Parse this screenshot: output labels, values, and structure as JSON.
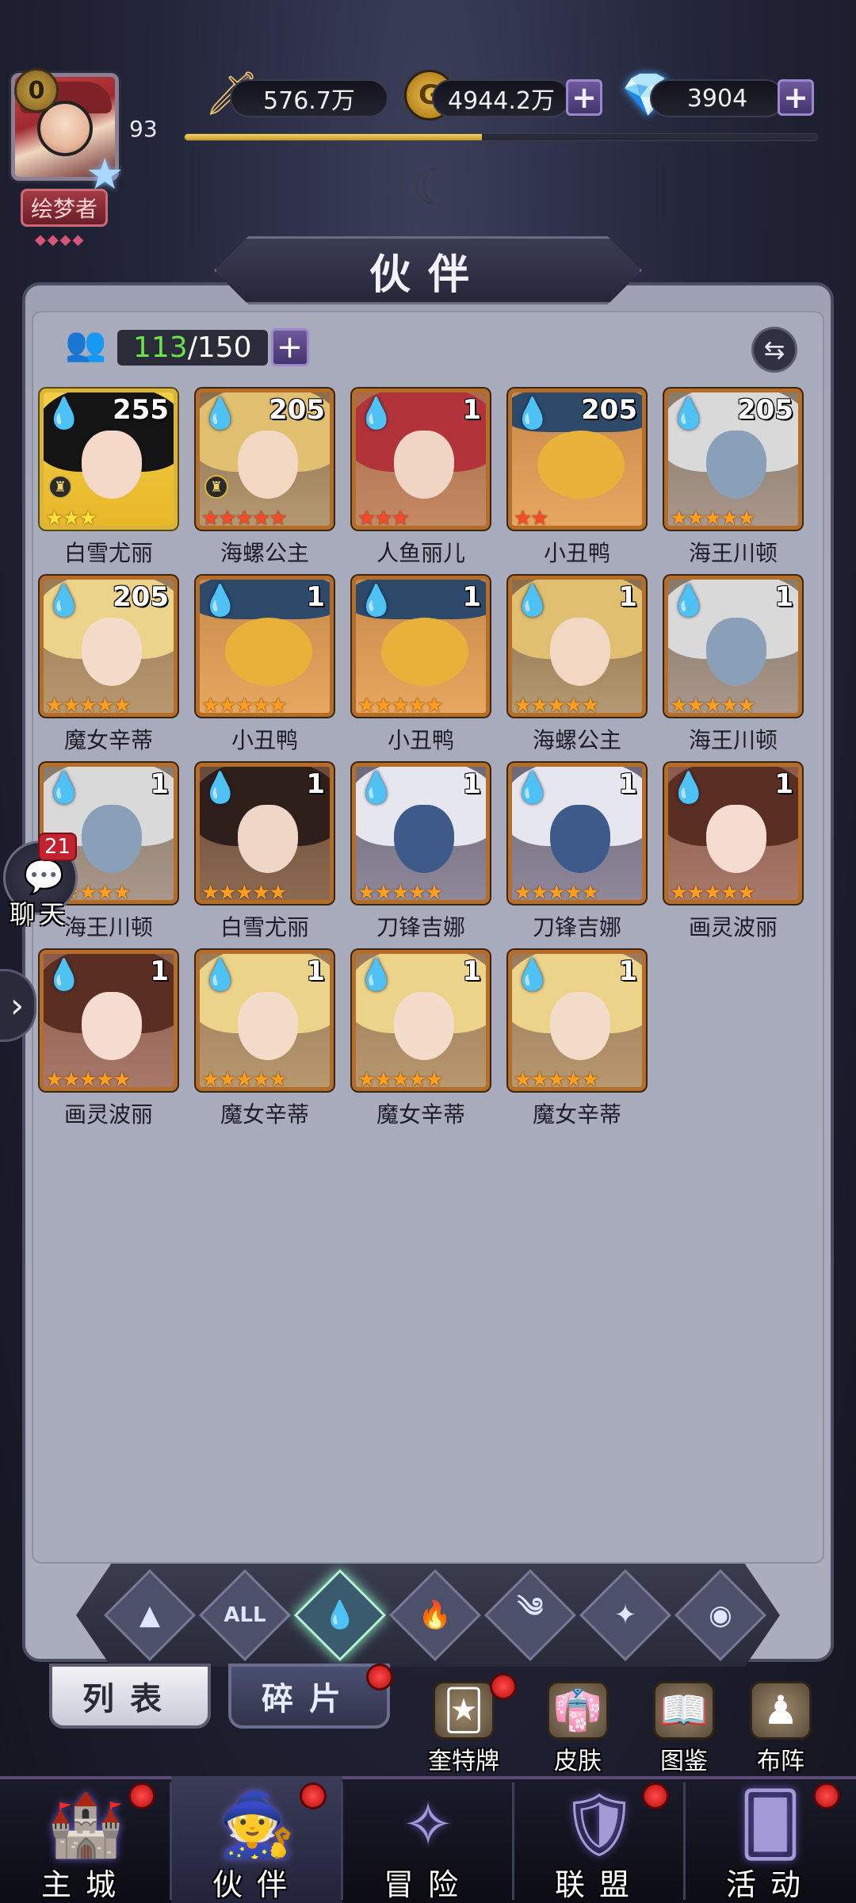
{
  "colors": {
    "accent_purple": "#6d5a9b",
    "panel_bg": "#a7abbb",
    "count_current": "#6ee24a",
    "red_dot": "#c32230",
    "frame_orange": "#b56d2a",
    "frame_gold": "#d9b53a"
  },
  "header": {
    "player_level_badge": "0",
    "player_level": "93",
    "player_title": "绘梦者",
    "power": "576.7万",
    "gold": "4944.2万",
    "gems": "3904",
    "exp_progress": 0.47,
    "panel_title": "伙伴"
  },
  "roster": {
    "count_current": "113",
    "count_max": "/150"
  },
  "heroes": [
    {
      "name": "白雪尤丽",
      "level": "255",
      "stars": 3,
      "star_color": "yellow",
      "frame": "gold",
      "palette": "snow",
      "crown": true
    },
    {
      "name": "海螺公主",
      "level": "205",
      "stars": 5,
      "star_color": "red",
      "frame": "orange",
      "palette": "sea",
      "crown": true
    },
    {
      "name": "人鱼丽儿",
      "level": "1",
      "stars": 3,
      "star_color": "red",
      "frame": "orange",
      "palette": "mer",
      "crown": false
    },
    {
      "name": "小丑鸭",
      "level": "205",
      "stars": 2,
      "star_color": "red",
      "frame": "orange",
      "palette": "duck",
      "crown": false
    },
    {
      "name": "海王川顿",
      "level": "205",
      "stars": 5,
      "star_color": "orange",
      "frame": "orange",
      "palette": "posei",
      "crown": false
    },
    {
      "name": "魔女辛蒂",
      "level": "205",
      "stars": 5,
      "star_color": "orange",
      "frame": "orange",
      "palette": "witch",
      "crown": false
    },
    {
      "name": "小丑鸭",
      "level": "1",
      "stars": 5,
      "star_color": "orange",
      "frame": "orange",
      "palette": "duck",
      "crown": false
    },
    {
      "name": "小丑鸭",
      "level": "1",
      "stars": 5,
      "star_color": "orange",
      "frame": "orange",
      "palette": "duck",
      "crown": false
    },
    {
      "name": "海螺公主",
      "level": "1",
      "stars": 5,
      "star_color": "orange",
      "frame": "orange",
      "palette": "sea",
      "crown": false
    },
    {
      "name": "海王川顿",
      "level": "1",
      "stars": 5,
      "star_color": "orange",
      "frame": "orange",
      "palette": "posei",
      "crown": false
    },
    {
      "name": "海王川顿",
      "level": "1",
      "stars": 5,
      "star_color": "orange",
      "frame": "orange",
      "palette": "posei",
      "crown": false
    },
    {
      "name": "白雪尤丽",
      "level": "1",
      "stars": 5,
      "star_color": "orange",
      "frame": "orange",
      "palette": "dark",
      "crown": false
    },
    {
      "name": "刀锋吉娜",
      "level": "1",
      "stars": 5,
      "star_color": "orange",
      "frame": "orange",
      "palette": "blade",
      "crown": false
    },
    {
      "name": "刀锋吉娜",
      "level": "1",
      "stars": 5,
      "star_color": "orange",
      "frame": "orange",
      "palette": "blade",
      "crown": false
    },
    {
      "name": "画灵波丽",
      "level": "1",
      "stars": 5,
      "star_color": "orange",
      "frame": "orange",
      "palette": "paint",
      "crown": false
    },
    {
      "name": "画灵波丽",
      "level": "1",
      "stars": 5,
      "star_color": "orange",
      "frame": "orange",
      "palette": "paint",
      "crown": false
    },
    {
      "name": "魔女辛蒂",
      "level": "1",
      "stars": 5,
      "star_color": "orange",
      "frame": "orange",
      "palette": "witch",
      "crown": false
    },
    {
      "name": "魔女辛蒂",
      "level": "1",
      "stars": 5,
      "star_color": "orange",
      "frame": "orange",
      "palette": "witch",
      "crown": false
    },
    {
      "name": "魔女辛蒂",
      "level": "1",
      "stars": 5,
      "star_color": "orange",
      "frame": "orange",
      "palette": "witch",
      "crown": false
    }
  ],
  "chat": {
    "label": "聊天",
    "unread": "21"
  },
  "filters": [
    {
      "id": "light",
      "glyph": "▲"
    },
    {
      "id": "all",
      "glyph": "ALL"
    },
    {
      "id": "water",
      "glyph": "💧",
      "active": true
    },
    {
      "id": "fire",
      "glyph": "🔥"
    },
    {
      "id": "wind",
      "glyph": "༄"
    },
    {
      "id": "star",
      "glyph": "✦"
    },
    {
      "id": "dark",
      "glyph": "◉"
    }
  ],
  "subtabs": {
    "list": "列表",
    "fragments": "碎片"
  },
  "tools": [
    {
      "label": "奎特牌",
      "icon": "tarot-card-icon",
      "glyph": "🃏",
      "badge": true
    },
    {
      "label": "皮肤",
      "icon": "costume-icon",
      "glyph": "👘",
      "badge": false
    },
    {
      "label": "图鉴",
      "icon": "codex-icon",
      "glyph": "📖",
      "badge": false
    },
    {
      "label": "布阵",
      "icon": "formation-icon",
      "glyph": "♟",
      "badge": false
    }
  ],
  "nav": [
    {
      "label": "主城",
      "icon": "castle-icon",
      "glyph": "🏰",
      "badge": true,
      "active": false
    },
    {
      "label": "伙伴",
      "icon": "witch-hat-icon",
      "glyph": "🧙",
      "badge": true,
      "active": true
    },
    {
      "label": "冒险",
      "icon": "compass-icon",
      "glyph": "✧",
      "badge": false,
      "active": false
    },
    {
      "label": "联盟",
      "icon": "shield-icon",
      "glyph": "🛡",
      "badge": true,
      "active": false
    },
    {
      "label": "活动",
      "icon": "cards-icon",
      "glyph": "🂠",
      "badge": true,
      "active": false
    }
  ]
}
